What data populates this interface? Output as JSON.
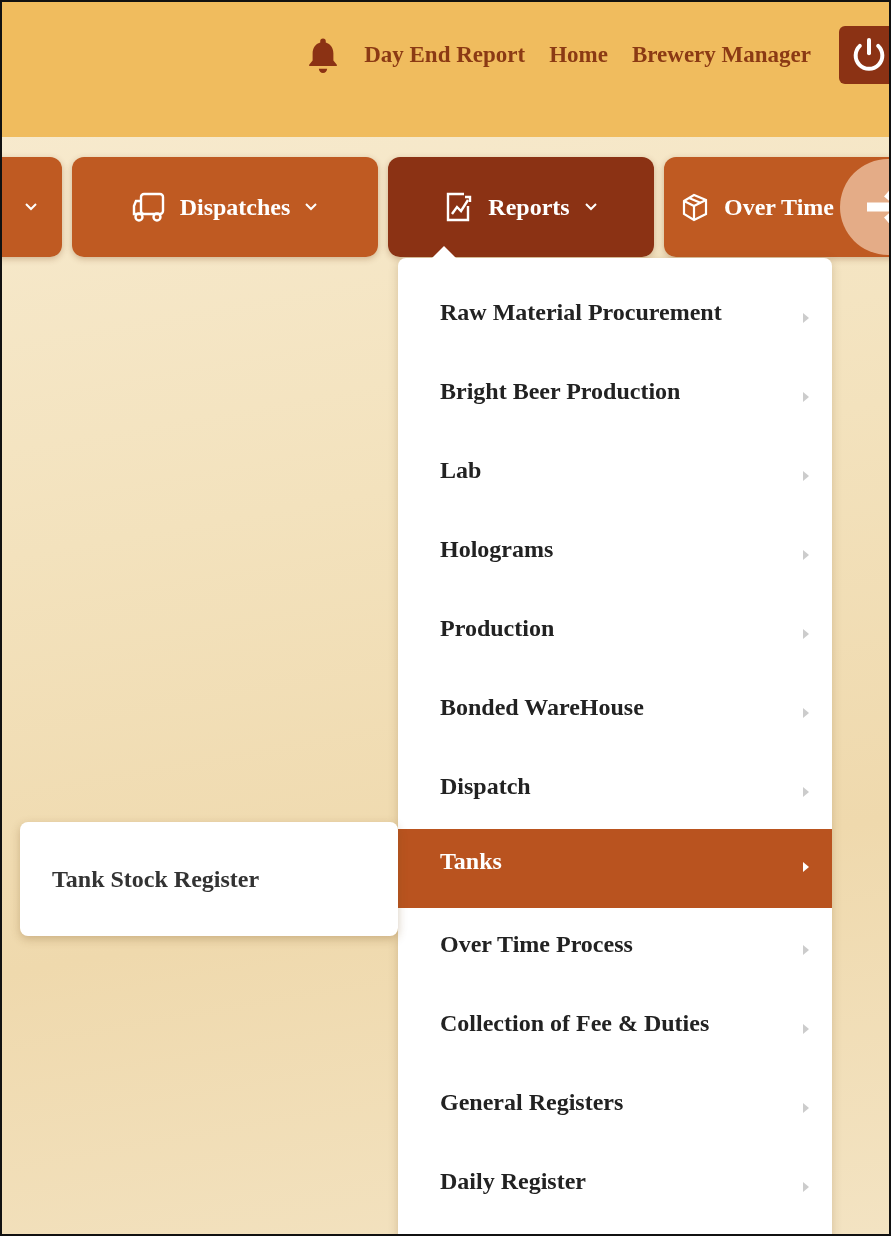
{
  "header": {
    "links": [
      {
        "label": "Day End Report"
      },
      {
        "label": "Home"
      },
      {
        "label": "Brewery Manager"
      }
    ]
  },
  "nav_tabs": [
    {
      "kind": "partial",
      "selected": false
    },
    {
      "kind": "full",
      "label": "Dispatches",
      "selected": false
    },
    {
      "kind": "full",
      "label": "Reports",
      "selected": true
    },
    {
      "kind": "full",
      "label": "Over Time",
      "selected": false
    }
  ],
  "reports_menu": {
    "items": [
      {
        "label": "Raw Material Procurement",
        "selected": false
      },
      {
        "label": "Bright Beer Production",
        "selected": false
      },
      {
        "label": "Lab",
        "selected": false
      },
      {
        "label": "Holograms",
        "selected": false
      },
      {
        "label": "Production",
        "selected": false
      },
      {
        "label": "Bonded WareHouse",
        "selected": false
      },
      {
        "label": "Dispatch",
        "selected": false
      },
      {
        "label": "Tanks",
        "selected": true
      },
      {
        "label": "Over Time Process",
        "selected": false
      },
      {
        "label": "Collection of Fee & Duties",
        "selected": false
      },
      {
        "label": "General Registers",
        "selected": false
      },
      {
        "label": "Daily Register",
        "selected": false
      }
    ]
  },
  "submenu": {
    "items": [
      {
        "label": "Tank Stock Register"
      }
    ]
  }
}
